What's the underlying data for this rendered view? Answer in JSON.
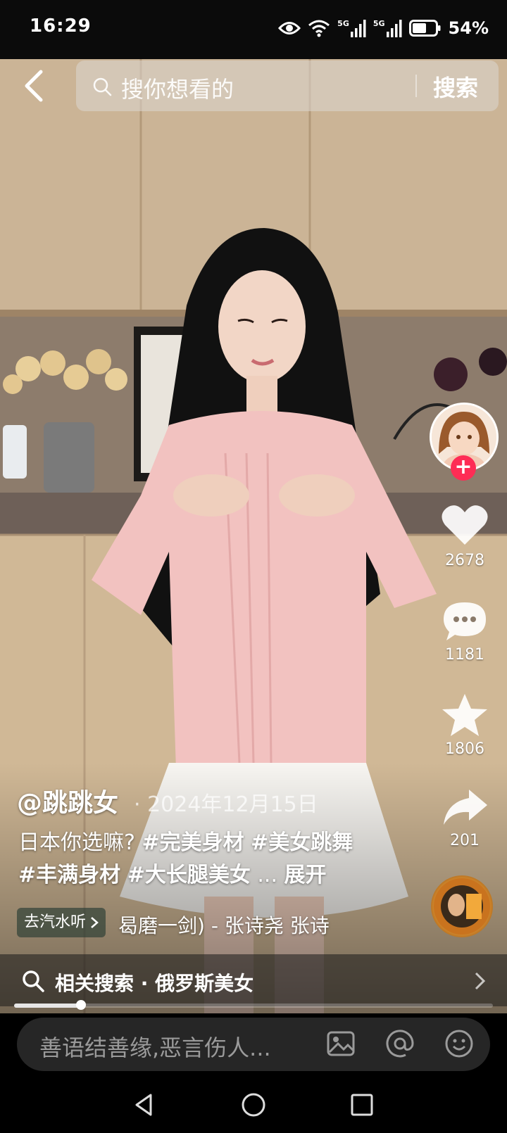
{
  "status_bar": {
    "time": "16:29",
    "battery": "54%",
    "network_label": "5G"
  },
  "search": {
    "placeholder": "搜你想看的",
    "submit_label": "搜索"
  },
  "actions": {
    "likes": "2678",
    "comments": "1181",
    "favorites": "1806",
    "shares": "201"
  },
  "post": {
    "author": "@跳跳女",
    "date": "· 2024年12月15日",
    "caption_text": "日本你选嘛?",
    "hashtags_line1": [
      "#完美身材",
      "#美女跳舞"
    ],
    "hashtags_line2": [
      "#丰满身材",
      "#大长腿美女"
    ],
    "ellipsis": "...",
    "expand_label": "展开"
  },
  "music": {
    "chip_label": "去汽水听",
    "title": "曷磨一剑) - 张诗尧    张诗"
  },
  "related": {
    "label": "相关搜索 · 俄罗斯美女"
  },
  "progress": {
    "fraction": 0.14
  },
  "comment": {
    "placeholder": "善语结善缘,恶言伤人..."
  },
  "colors": {
    "accent": "#fe2c55",
    "status_bar_bg": "#0b0b0b",
    "comment_bar_bg": "#262626"
  },
  "icons": {
    "back": "back-arrow-icon",
    "search": "search-icon",
    "like": "heart-icon",
    "comment": "comment-bubble-icon",
    "favorite": "star-icon",
    "share": "share-arrow-icon",
    "image": "image-icon",
    "mention": "at-icon",
    "emoji": "emoji-icon"
  }
}
